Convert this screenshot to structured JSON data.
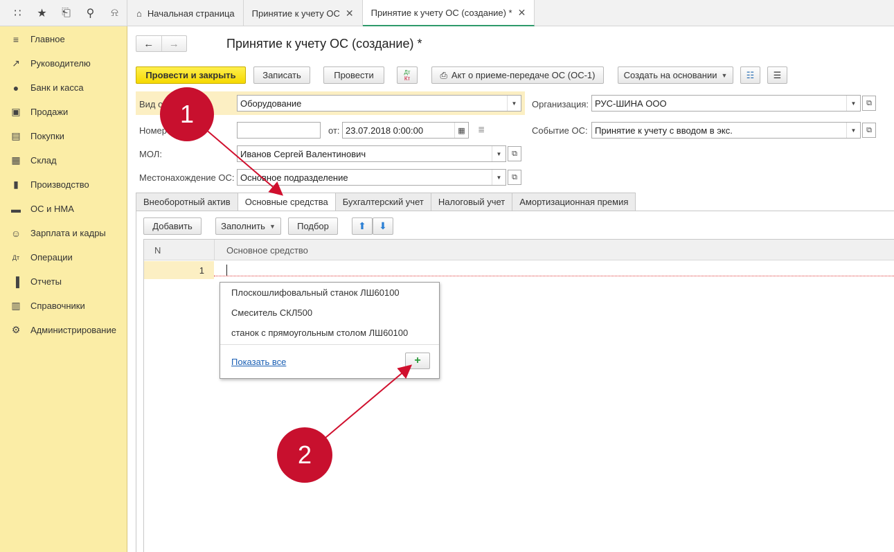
{
  "topbar": {
    "tabs": [
      {
        "label": "Начальная страница"
      },
      {
        "label": "Принятие к учету ОС"
      },
      {
        "label": "Принятие к учету ОС (создание) *"
      }
    ]
  },
  "sidebar": {
    "items": [
      {
        "label": "Главное",
        "icon": "menu-lines-icon"
      },
      {
        "label": "Руководителю",
        "icon": "trend-icon"
      },
      {
        "label": "Банк и касса",
        "icon": "coin-icon"
      },
      {
        "label": "Продажи",
        "icon": "bag-icon"
      },
      {
        "label": "Покупки",
        "icon": "cart-icon"
      },
      {
        "label": "Склад",
        "icon": "grid-icon"
      },
      {
        "label": "Производство",
        "icon": "factory-icon"
      },
      {
        "label": "ОС и НМА",
        "icon": "truck-icon"
      },
      {
        "label": "Зарплата и кадры",
        "icon": "person-icon"
      },
      {
        "label": "Операции",
        "icon": "dt-kt-icon"
      },
      {
        "label": "Отчеты",
        "icon": "bar-chart-icon"
      },
      {
        "label": "Справочники",
        "icon": "books-icon"
      },
      {
        "label": "Администрирование",
        "icon": "gear-icon"
      }
    ]
  },
  "form": {
    "title": "Принятие к учету ОС (создание) *",
    "toolbar": {
      "post_close": "Провести и закрыть",
      "save": "Записать",
      "post": "Провести",
      "dtkt": "Дт Кт",
      "act": "Акт о приеме-передаче ОС (ОС-1)",
      "create_based": "Создать на основании"
    },
    "fields": {
      "vid_label": "Вид о",
      "vid_value": "Оборудование",
      "number_label": "Номер",
      "number_value": "",
      "from_label": "от:",
      "date_value": "23.07.2018  0:00:00",
      "mol_label": "МОЛ:",
      "mol_value": "Иванов Сергей Валентинович",
      "location_label": "Местонахождение ОС:",
      "location_value": "Основное подразделение",
      "org_label": "Организация:",
      "org_value": "РУС-ШИНА ООО",
      "event_label": "Событие ОС:",
      "event_value": "Принятие к учету с вводом в экс."
    },
    "tabs": [
      {
        "label": "Внеоборотный актив"
      },
      {
        "label": "Основные средства"
      },
      {
        "label": "Бухгалтерский учет"
      },
      {
        "label": "Налоговый учет"
      },
      {
        "label": "Амортизационная премия"
      }
    ],
    "table_toolbar": {
      "add": "Добавить",
      "fill": "Заполнить",
      "select": "Подбор"
    },
    "table": {
      "columns": [
        "N",
        "Основное средство"
      ],
      "rows": [
        {
          "n": "1",
          "asset": ""
        }
      ]
    },
    "dropdown": {
      "items": [
        "Плоскошлифовальный станок ЛШ60100",
        "Смеситель СКЛ500",
        "станок с прямоугольным столом ЛШ60100"
      ],
      "show_all": "Показать все",
      "add_symbol": "+"
    }
  },
  "annotations": {
    "marker1": "1",
    "marker2": "2",
    "color": "#c8102e"
  }
}
